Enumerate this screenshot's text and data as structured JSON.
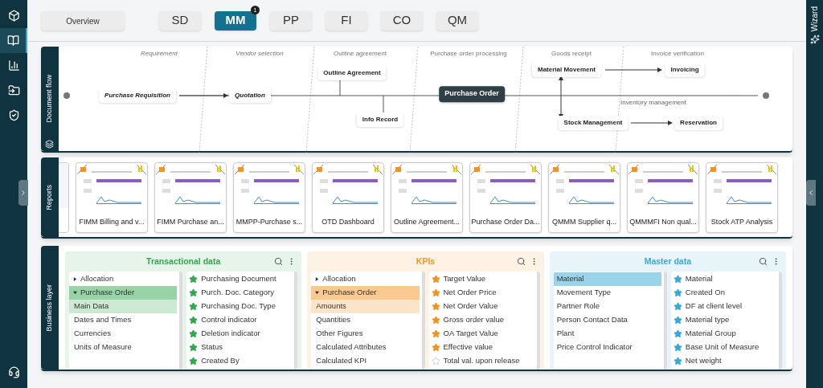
{
  "sidebar": {
    "items": [
      {
        "selected": false
      },
      {
        "selected": true
      },
      {
        "selected": false
      },
      {
        "selected": false
      },
      {
        "selected": false
      }
    ]
  },
  "tabs": [
    {
      "label": "Overview",
      "selected": false
    },
    {
      "label": "SD",
      "selected": false
    },
    {
      "label": "MM",
      "selected": true,
      "badge": "1"
    },
    {
      "label": "PP",
      "selected": false
    },
    {
      "label": "FI",
      "selected": false
    },
    {
      "label": "CO",
      "selected": false
    },
    {
      "label": "QM",
      "selected": false
    }
  ],
  "wizard": {
    "label": "Wizard"
  },
  "document_flow": {
    "title": "Document flow",
    "phases": [
      "Requirement",
      "Vendor selection",
      "Outline agreement",
      "Purchase order processing",
      "Goods receipt",
      "Invoice verification"
    ],
    "lane": "Inventory management",
    "nodes": [
      {
        "label": "Purchase Requisition",
        "selected": false
      },
      {
        "label": "Quotation",
        "selected": false
      },
      {
        "label": "Outline Agreement",
        "selected": false
      },
      {
        "label": "Info Record",
        "selected": false
      },
      {
        "label": "Purchase Order",
        "selected": true
      },
      {
        "label": "Material Movement",
        "selected": false
      },
      {
        "label": "Invoicing",
        "selected": false
      },
      {
        "label": "Stock Management",
        "selected": false
      },
      {
        "label": "Reservation",
        "selected": false
      }
    ]
  },
  "reports": {
    "title": "Reports",
    "cards": [
      {
        "title": "FIMM Billing and v..."
      },
      {
        "title": "FIMM Purchase an..."
      },
      {
        "title": "MMPP-Purchase s..."
      },
      {
        "title": "OTD Dashboard"
      },
      {
        "title": "Outline Agreement..."
      },
      {
        "title": "Purchase Order Da..."
      },
      {
        "title": "QMMM Supplier q..."
      },
      {
        "title": "QMMMFI Non qual..."
      },
      {
        "title": "Stock ATP Analysis"
      }
    ]
  },
  "business_layer": {
    "title": "Business layer",
    "sections": [
      {
        "title": "Transactional data",
        "color": "#2fa84f",
        "tree": [
          {
            "label": "Allocation",
            "expanded": false,
            "selected": false
          },
          {
            "label": "Purchase Order",
            "expanded": true,
            "selected": true,
            "children": [
              {
                "label": "Main Data",
                "selected": true
              },
              {
                "label": "Dates and Times",
                "selected": false
              },
              {
                "label": "Currencies",
                "selected": false
              },
              {
                "label": "Units of Measure",
                "selected": false
              }
            ]
          }
        ],
        "fields": [
          {
            "label": "Purchasing Document",
            "starred": true
          },
          {
            "label": "Purch. Doc. Category",
            "starred": true
          },
          {
            "label": "Purchasing Doc. Type",
            "starred": true
          },
          {
            "label": "Control indicator",
            "starred": true
          },
          {
            "label": "Deletion indicator",
            "starred": true
          },
          {
            "label": "Status",
            "starred": true
          },
          {
            "label": "Created By",
            "starred": true
          }
        ]
      },
      {
        "title": "KPIs",
        "color": "#f39422",
        "tree": [
          {
            "label": "Allocation",
            "expanded": false,
            "selected": false
          },
          {
            "label": "Purchase Order",
            "expanded": true,
            "selected": true,
            "children": [
              {
                "label": "Amounts",
                "selected": true
              },
              {
                "label": "Quantities",
                "selected": false
              },
              {
                "label": "Other Figures",
                "selected": false
              },
              {
                "label": "Calculated Attributes",
                "selected": false
              },
              {
                "label": "Calculated KPI",
                "selected": false
              }
            ]
          }
        ],
        "fields": [
          {
            "label": "Target Value",
            "starred": true
          },
          {
            "label": "Net Order Price",
            "starred": true
          },
          {
            "label": "Net Order Value",
            "starred": true
          },
          {
            "label": "Gross order value",
            "starred": true
          },
          {
            "label": "OA Target Value",
            "starred": true
          },
          {
            "label": "Effective value",
            "starred": true
          },
          {
            "label": "Total val. upon release",
            "starred": false
          }
        ]
      },
      {
        "title": "Master data",
        "color": "#36a9d8",
        "tree": [
          {
            "label": "Material",
            "selected": true
          },
          {
            "label": "Movement Type",
            "selected": false
          },
          {
            "label": "Partner Role",
            "selected": false
          },
          {
            "label": "Person Contact Data",
            "selected": false
          },
          {
            "label": "Plant",
            "selected": false
          },
          {
            "label": "Price Control Indicator",
            "selected": false
          }
        ],
        "fields": [
          {
            "label": "Material",
            "starred": true
          },
          {
            "label": "Created On",
            "starred": true
          },
          {
            "label": "DF at client level",
            "starred": true
          },
          {
            "label": "Material type",
            "starred": true
          },
          {
            "label": "Material Group",
            "starred": true
          },
          {
            "label": "Base Unit of Measure",
            "starred": true
          },
          {
            "label": "Net weight",
            "starred": true
          }
        ]
      }
    ]
  }
}
